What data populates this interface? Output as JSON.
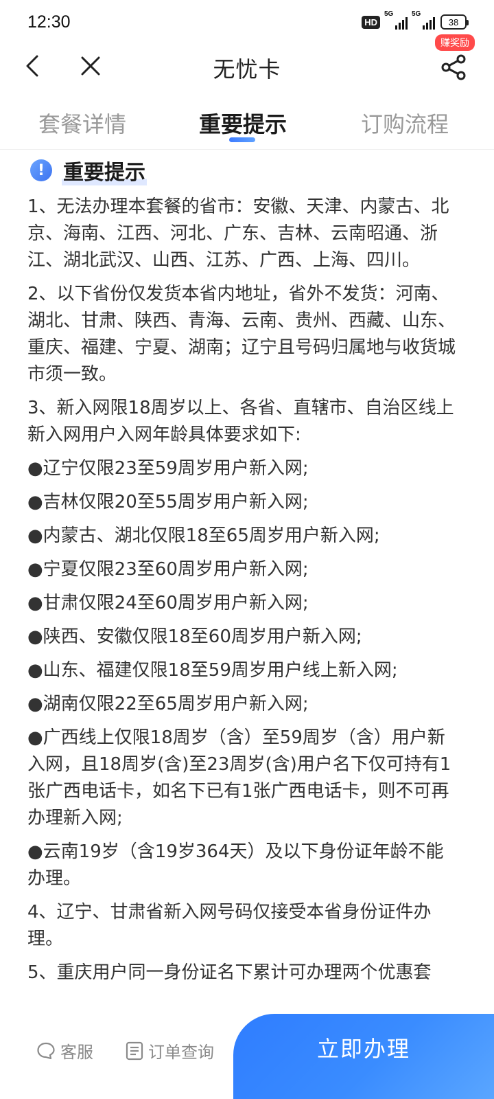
{
  "status_bar": {
    "time": "12:30",
    "hd": "HD",
    "signal1": "5G",
    "signal2": "5G",
    "battery": "38"
  },
  "nav": {
    "title": "无忧卡",
    "reward_badge": "赚奖励"
  },
  "tabs": [
    {
      "label": "套餐详情",
      "active": false
    },
    {
      "label": "重要提示",
      "active": true
    },
    {
      "label": "订购流程",
      "active": false
    }
  ],
  "section": {
    "title": "重要提示"
  },
  "paragraphs": [
    "1、无法办理本套餐的省市：安徽、天津、内蒙古、北京、海南、江西、河北、广东、吉林、云南昭通、浙江、湖北武汉、山西、江苏、广西、上海、四川。",
    "2、以下省份仅发货本省内地址，省外不发货：河南、湖北、甘肃、陕西、青海、云南、贵州、西藏、山东、重庆、福建、宁夏、湖南；辽宁且号码归属地与收货城市须一致。",
    "3、新入网限18周岁以上、各省、直辖市、自治区线上新入网用户入网年龄具体要求如下:"
  ],
  "bullets": [
    "●辽宁仅限23至59周岁用户新入网;",
    "●吉林仅限20至55周岁用户新入网;",
    "●内蒙古、湖北仅限18至65周岁用户新入网;",
    "●宁夏仅限23至60周岁用户新入网;",
    "●甘肃仅限24至60周岁用户新入网;",
    "●陕西、安徽仅限18至60周岁用户新入网;",
    "●山东、福建仅限18至59周岁用户线上新入网;",
    "●湖南仅限22至65周岁用户新入网;",
    "●广西线上仅限18周岁（含）至59周岁（含）用户新入网，且18周岁(含)至23周岁(含)用户名下仅可持有1张广西电话卡，如名下已有1张广西电话卡，则不可再办理新入网;",
    "●云南19岁（含19岁364天）及以下身份证年龄不能办理。"
  ],
  "paragraphs_after": [
    "4、辽宁、甘肃省新入网号码仅接受本省身份证件办理。",
    "5、重庆用户同一身份证名下累计可办理两个优惠套"
  ],
  "bottom": {
    "service": "客服",
    "order_query": "订单查询",
    "cta": "立即办理"
  },
  "colors": {
    "accent": "#3a86ff",
    "badge": "#ff4a4a"
  }
}
